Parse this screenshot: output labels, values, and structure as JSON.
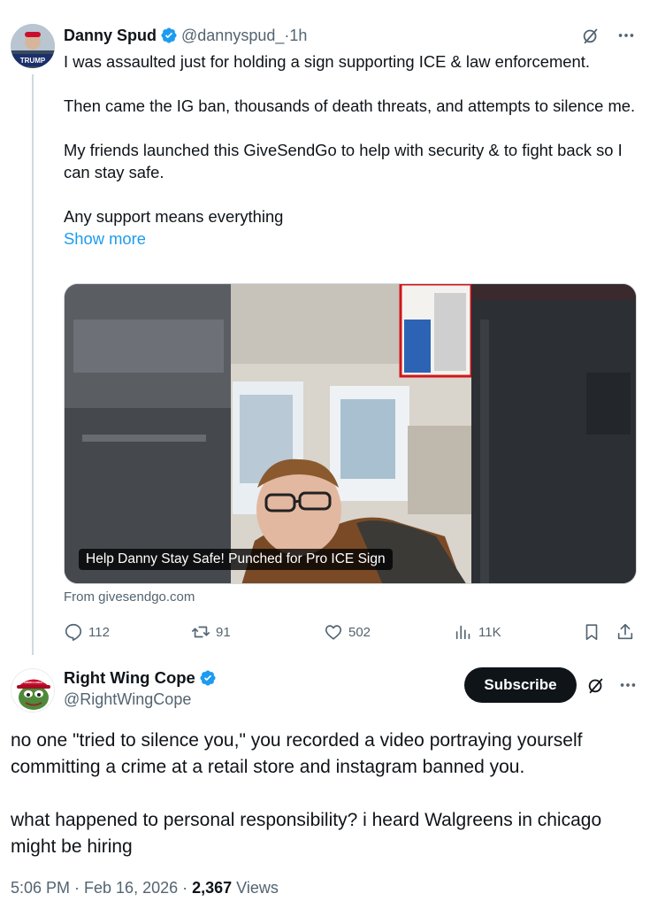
{
  "parent_tweet": {
    "author_name": "Danny Spud",
    "author_handle": "@dannyspud_",
    "time_sep": " · ",
    "time": "1h",
    "avatar_sign_text": "TRUMP",
    "paragraphs": [
      "I was assaulted just for holding a sign supporting ICE & law enforcement.",
      "Then came the IG ban, thousands of death threats, and attempts to silence me.",
      "My friends launched this GiveSendGo to help with security & to fight back so I can stay safe.",
      "Any support means everything"
    ],
    "show_more": "Show more",
    "card": {
      "caption": "Help Danny Stay Safe! Punched for Pro ICE Sign",
      "source": "From givesendgo.com"
    },
    "actions": {
      "replies": "112",
      "reposts": "91",
      "likes": "502",
      "views": "11K"
    }
  },
  "reply_tweet": {
    "author_name": "Right Wing Cope",
    "author_handle": "@RightWingCope",
    "avatar_hat_text": "MAKE AMERICA GREAT AGAIN",
    "subscribe_label": "Subscribe",
    "paragraphs": [
      "no one \"tried to silence you,\" you recorded a video portraying yourself committing a crime at a retail store and instagram banned you.",
      "what happened to personal responsibility? i heard Walgreens in chicago might be hiring"
    ],
    "timestamp": "5:06 PM · Feb 16, 2026 · ",
    "views_count": "2,367",
    "views_label": " Views"
  },
  "colors": {
    "accent": "#1d9bf0",
    "text": "#0f1419",
    "secondary": "#536471",
    "verified": "#1d9bf0"
  }
}
